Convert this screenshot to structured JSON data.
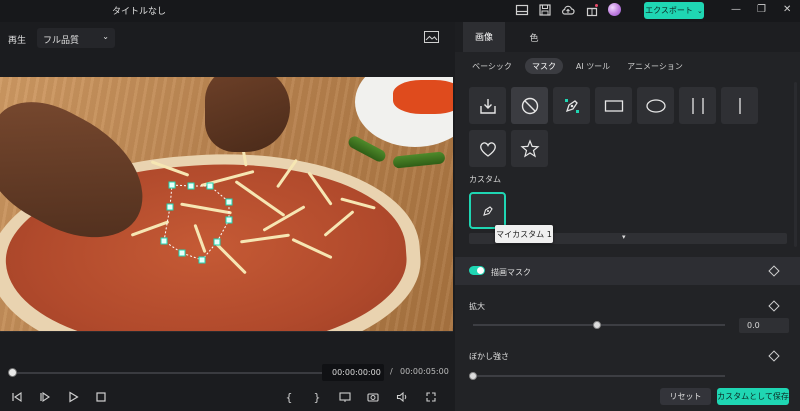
{
  "app": {
    "title": "タイトルなし",
    "export_label": "エクスポート",
    "accent_color": "#1fd6b3"
  },
  "titlebar_icons": [
    "layout-icon",
    "save-icon",
    "cloud-upload-icon",
    "gift-icon",
    "avatar"
  ],
  "preview": {
    "mode_label": "再生",
    "quality": "フル品質",
    "timecode_current": "00:00:00:00",
    "timecode_separator": "/",
    "timecode_total": "00:00:05:00",
    "playhead_fraction": 0.0
  },
  "controls": [
    "step-back-icon",
    "play-step-icon",
    "play-icon",
    "stop-icon",
    "mark-in-icon",
    "mark-out-icon",
    "display-icon",
    "snapshot-icon",
    "volume-icon",
    "fullscreen-icon"
  ],
  "panel": {
    "tabs": [
      {
        "label": "画像",
        "active": true
      },
      {
        "label": "色",
        "active": false
      }
    ],
    "subtabs": [
      {
        "label": "ベーシック",
        "active": false
      },
      {
        "label": "マスク",
        "active": true
      },
      {
        "label": "AI ツール",
        "active": false
      },
      {
        "label": "アニメーション",
        "active": false
      }
    ],
    "mask_shapes": [
      "import-mask-icon",
      "none-icon",
      "pen-icon",
      "rectangle-icon",
      "ellipse-icon",
      "double-line-icon",
      "single-line-icon",
      "heart-icon",
      "star-icon"
    ],
    "custom_label": "カスタム",
    "custom_tooltip": "マイカスタム 1",
    "draw_mask_label": "描画マスク",
    "draw_mask_on": true,
    "scale_label": "拡大",
    "scale_value": "0.0",
    "scale_fraction": 0.5,
    "blur_label": "ぼかし強さ",
    "blur_fraction": 0.0,
    "reset_label": "リセット",
    "save_custom_label": "カスタムとして保存"
  }
}
